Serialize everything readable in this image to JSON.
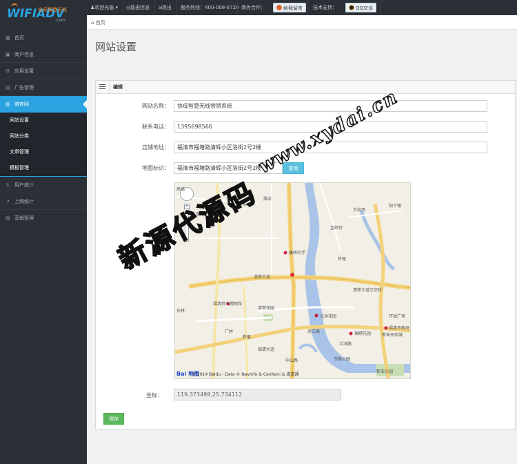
{
  "logo": {
    "brand": "WIFIADV",
    "brand_cn": "协成智慧无线",
    "url": ".com"
  },
  "topbar": {
    "welcome": "欢迎光临 ▾",
    "router_info": "路由信息",
    "logout": "退出",
    "hotline": "服务热线：400-008-6720",
    "business": "商务合作：",
    "leave_message": "给我留言",
    "tech_support": "技术支持：",
    "qq": "QQ交谈"
  },
  "breadcrumb": {
    "home": "首页"
  },
  "sidebar": {
    "items": [
      {
        "label": "首页",
        "icon": "dashboard-icon"
      },
      {
        "label": "商户信息",
        "icon": "store-icon"
      },
      {
        "label": "应用设置",
        "icon": "app-icon"
      },
      {
        "label": "广告管理",
        "icon": "ad-icon"
      },
      {
        "label": "微官网",
        "icon": "site-icon",
        "active": true
      }
    ],
    "sub_items": [
      {
        "label": "网站设置"
      },
      {
        "label": "网站分类"
      },
      {
        "label": "文章管理"
      },
      {
        "label": "模板管理"
      }
    ],
    "items_after": [
      {
        "label": "用户统计",
        "icon": "users-icon"
      },
      {
        "label": "上网统计",
        "icon": "stats-icon"
      },
      {
        "label": "营销管理",
        "icon": "marketing-icon"
      }
    ]
  },
  "main": {
    "title": "网站设置",
    "panel_title": "编辑",
    "fields": {
      "site_name": {
        "label": "网站名称：",
        "value": "协成智慧无线营销系统"
      },
      "phone": {
        "label": "联系电话：",
        "value": "1395698566"
      },
      "address": {
        "label": "店铺地址：",
        "value": "福清市福塘路清辉小区洛街2号2楼"
      },
      "map_mark": {
        "label": "地图标识：",
        "value": "福清市福塘路清辉小区洛街2号2楼",
        "button": "查询"
      },
      "coordinates": {
        "label": "坐标：",
        "value": "119.373499,25.734112"
      }
    },
    "save_button": "保存"
  },
  "map": {
    "labels": [
      "高墙",
      "前塘",
      "殊洋",
      "宏路",
      "大校场",
      "阳下镇",
      "金岭村",
      "康辉中学",
      "岭尾",
      "清荣大道",
      "福清侨乡博物馆",
      "清荣花园",
      "元洪花园",
      "环球广场",
      "锦绣花园",
      "福清市政府",
      "新亚天商城",
      "龙江路",
      "江滨路",
      "玉融公园",
      "新亚乐园",
      "东林",
      "广林",
      "新厝",
      "清荣大道立交桥",
      "福清大道",
      "中山路"
    ],
    "copyright": "© 2014 Baidu - Data © NavInfo & CenNavi & 道道通",
    "baidu": "Bai 地图"
  },
  "watermark": {
    "url": "www.xydai.cn",
    "cn": "新源代源码"
  },
  "colors": {
    "accent": "#2aa3e0",
    "sidebar_bg": "#2b2f36",
    "save_green": "#5cb85c",
    "query_blue": "#5bc0de"
  }
}
